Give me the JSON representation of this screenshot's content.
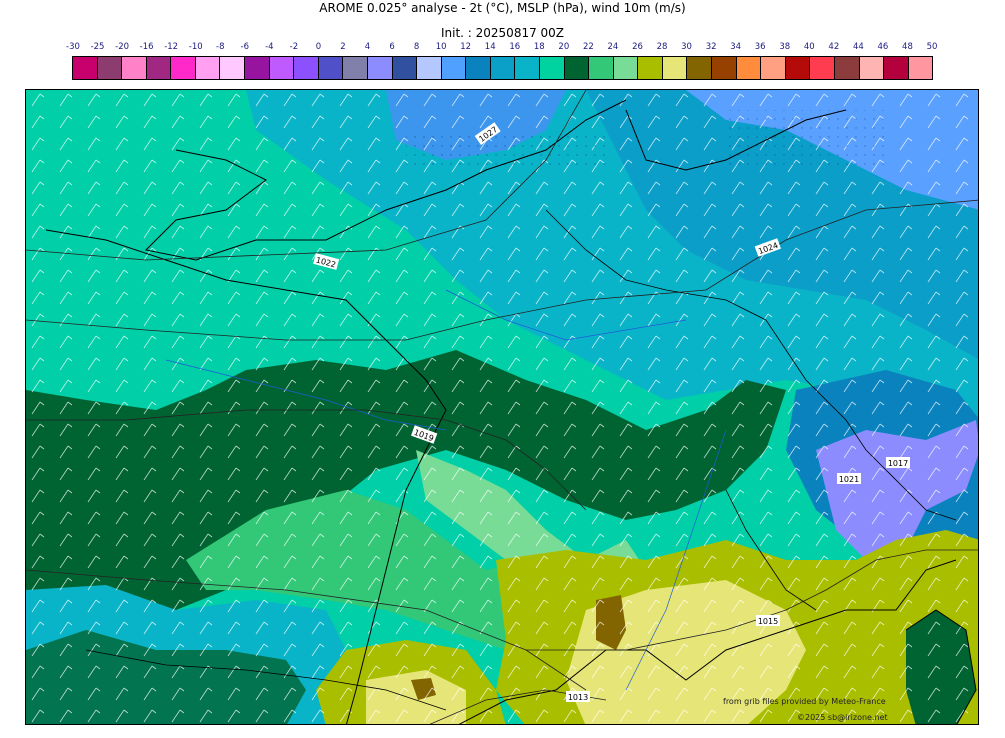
{
  "header": {
    "title": "AROME 0.025° analyse - 2t (°C), MSLP (hPa), wind 10m (m/s)",
    "init": "Init. : 20250817 00Z"
  },
  "legend": {
    "ticks": [
      "-30",
      "-25",
      "-20",
      "-16",
      "-12",
      "-10",
      "-8",
      "-6",
      "-4",
      "-2",
      "0",
      "2",
      "4",
      "6",
      "8",
      "10",
      "12",
      "14",
      "16",
      "18",
      "20",
      "22",
      "24",
      "26",
      "28",
      "30",
      "32",
      "34",
      "36",
      "38",
      "40",
      "42",
      "44",
      "46",
      "48",
      "50"
    ],
    "colors": [
      "#c8006e",
      "#8c3c6e",
      "#ff82c8",
      "#a02882",
      "#ff28c8",
      "#ffa0f0",
      "#ffc8ff",
      "#9614a0",
      "#be5aff",
      "#8c50ff",
      "#5050c8",
      "#8080aa",
      "#8c8cff",
      "#3250a0",
      "#b4c8ff",
      "#50a0ff",
      "#0a82be",
      "#0aa0c8",
      "#0ab4c8",
      "#00d2a0",
      "#006432",
      "#32c878",
      "#78dc96",
      "#aabe00",
      "#e6e678",
      "#826400",
      "#964100",
      "#ff8c3c",
      "#ffa082",
      "#b40a0a",
      "#ff3c50",
      "#8c3c3c",
      "#ffb4b4",
      "#b4003c",
      "#ff96a0"
    ]
  },
  "map": {
    "isobars": [
      {
        "label": "1027"
      },
      {
        "label": "1022"
      },
      {
        "label": "1024"
      },
      {
        "label": "1019"
      },
      {
        "label": "1013"
      },
      {
        "label": "1017"
      },
      {
        "label": "1021"
      },
      {
        "label": "1015"
      }
    ]
  },
  "credits": {
    "source": "from grib files provided by Meteo-France",
    "copyright": "©2025 sb@irizone.net"
  }
}
